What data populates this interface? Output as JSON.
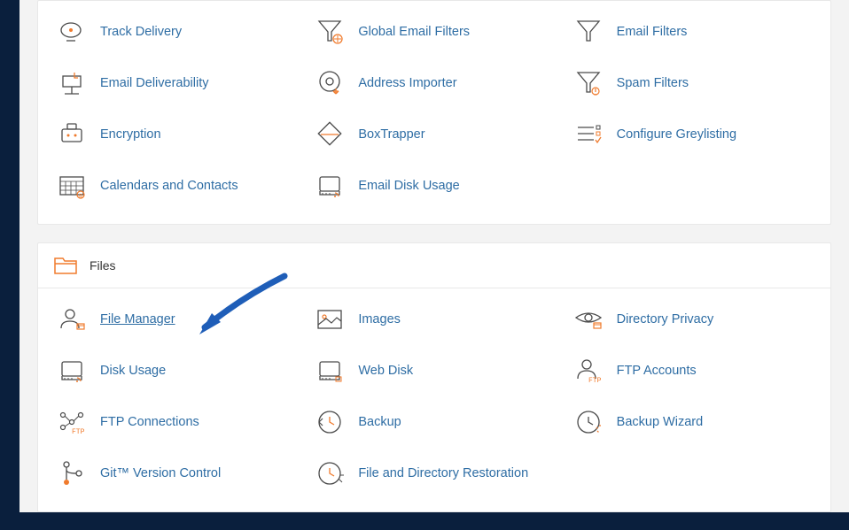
{
  "email_section": {
    "items": [
      {
        "key": "track-delivery",
        "label": "Track Delivery"
      },
      {
        "key": "global-email-filters",
        "label": "Global Email Filters"
      },
      {
        "key": "email-filters",
        "label": "Email Filters"
      },
      {
        "key": "email-deliverability",
        "label": "Email Deliverability"
      },
      {
        "key": "address-importer",
        "label": "Address Importer"
      },
      {
        "key": "spam-filters",
        "label": "Spam Filters"
      },
      {
        "key": "encryption",
        "label": "Encryption"
      },
      {
        "key": "boxtrapper",
        "label": "BoxTrapper"
      },
      {
        "key": "configure-greylisting",
        "label": "Configure Greylisting"
      },
      {
        "key": "calendars-contacts",
        "label": "Calendars and Contacts"
      },
      {
        "key": "email-disk-usage",
        "label": "Email Disk Usage"
      }
    ]
  },
  "files_section": {
    "title": "Files",
    "items": [
      {
        "key": "file-manager",
        "label": "File Manager",
        "highlight": true
      },
      {
        "key": "images",
        "label": "Images"
      },
      {
        "key": "directory-privacy",
        "label": "Directory Privacy"
      },
      {
        "key": "disk-usage",
        "label": "Disk Usage"
      },
      {
        "key": "web-disk",
        "label": "Web Disk"
      },
      {
        "key": "ftp-accounts",
        "label": "FTP Accounts"
      },
      {
        "key": "ftp-connections",
        "label": "FTP Connections"
      },
      {
        "key": "backup",
        "label": "Backup"
      },
      {
        "key": "backup-wizard",
        "label": "Backup Wizard"
      },
      {
        "key": "git-version-control",
        "label": "Git™ Version Control"
      },
      {
        "key": "file-directory-restoration",
        "label": "File and Directory Restoration"
      }
    ]
  },
  "colors": {
    "link": "#2e6da4",
    "iconStroke": "#4a4a4a",
    "iconAccent": "#f07b2d",
    "arrow": "#1f5eb8"
  }
}
